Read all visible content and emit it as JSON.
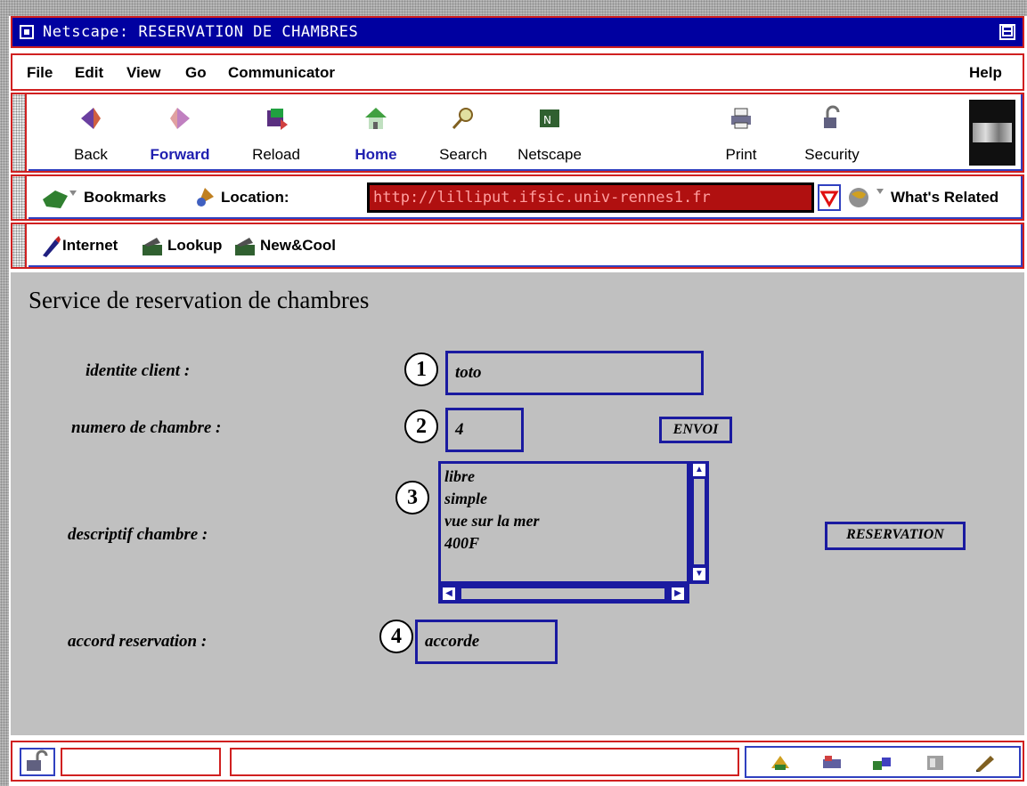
{
  "window": {
    "title": "Netscape: RESERVATION DE CHAMBRES"
  },
  "menu": {
    "file": "File",
    "edit": "Edit",
    "view": "View",
    "go": "Go",
    "communicator": "Communicator",
    "help": "Help"
  },
  "toolbar": {
    "back": "Back",
    "forward": "Forward",
    "reload": "Reload",
    "home": "Home",
    "search": "Search",
    "netscape": "Netscape",
    "print": "Print",
    "security": "Security"
  },
  "location_bar": {
    "bookmarks": "Bookmarks",
    "location_label": "Location:",
    "url": "http://lilliput.ifsic.univ-rennes1.fr",
    "whats_related": "What's Related"
  },
  "personal_bar": {
    "internet": "Internet",
    "lookup": "Lookup",
    "new_cool": "New&Cool"
  },
  "page": {
    "heading": "Service de reservation de chambres",
    "labels": {
      "client": "identite client :",
      "room_number": "numero de chambre :",
      "description": "descriptif chambre :",
      "agreement": "accord reservation :"
    },
    "markers": [
      "1",
      "2",
      "3",
      "4"
    ],
    "fields": {
      "client": "toto",
      "room_number": "4",
      "agreement": "accorde"
    },
    "description_lines": [
      "libre",
      "simple",
      "vue sur la mer",
      "400F"
    ],
    "buttons": {
      "send": "ENVOI",
      "reserve": "RESERVATION"
    }
  },
  "colors": {
    "title_bar": "#0000a0",
    "chrome_border": "#d02020",
    "form_border": "#1a1aa0",
    "location_field": "#b01010",
    "page_background": "#c0c0c0"
  }
}
